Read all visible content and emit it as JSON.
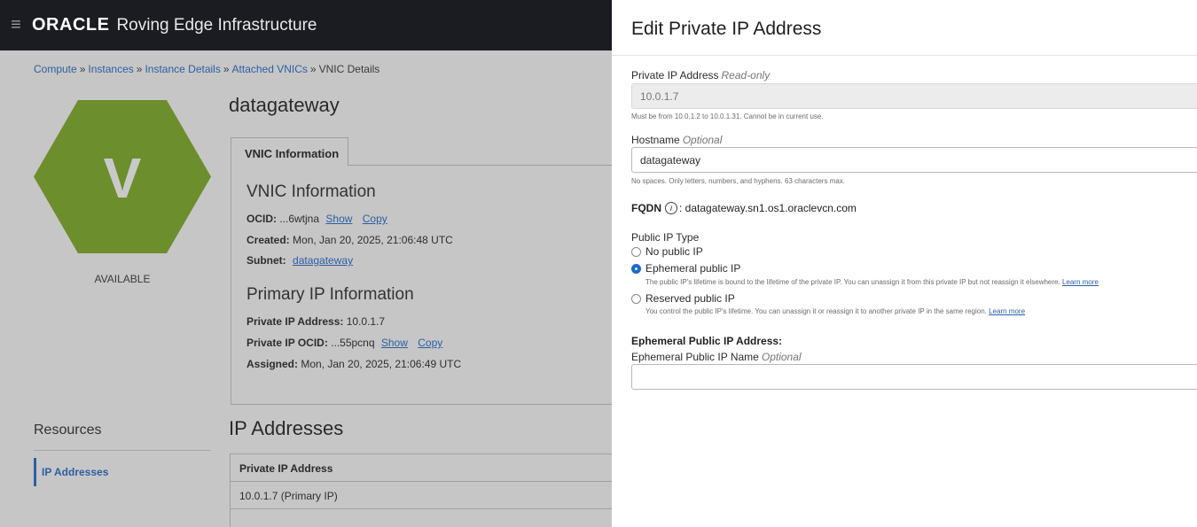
{
  "header": {
    "menu_icon": "hamburger-icon",
    "logo": "ORACLE",
    "product": "Roving Edge Infrastructure"
  },
  "breadcrumb": {
    "items": [
      "Compute",
      "Instances",
      "Instance Details",
      "Attached VNICs"
    ],
    "separator": "»",
    "current": "VNIC Details"
  },
  "resource": {
    "badge_letter": "V",
    "badge_color": "#6c8e2d",
    "status": "AVAILABLE",
    "name": "datagateway"
  },
  "tabs": [
    {
      "label": "VNIC Information"
    }
  ],
  "vnic_info": {
    "heading": "VNIC Information",
    "ocid_label": "OCID:",
    "ocid_value": "...6wtjna",
    "show_link": "Show",
    "copy_link": "Copy",
    "created_label": "Created:",
    "created_value": "Mon, Jan 20, 2025, 21:06:48 UTC",
    "subnet_label": "Subnet:",
    "subnet_value": "datagateway"
  },
  "primary_ip": {
    "heading": "Primary IP Information",
    "private_ip_label": "Private IP Address:",
    "private_ip_value": "10.0.1.7",
    "ocid_label": "Private IP OCID:",
    "ocid_value": "...55pcnq",
    "show_link": "Show",
    "copy_link": "Copy",
    "assigned_label": "Assigned:",
    "assigned_value": "Mon, Jan 20, 2025, 21:06:49 UTC"
  },
  "resources": {
    "heading": "Resources",
    "items": [
      {
        "label": "IP Addresses"
      }
    ]
  },
  "ip_section": {
    "heading": "IP Addresses",
    "columns": [
      "Private IP Address"
    ],
    "rows": [
      "10.0.1.7 (Primary IP)"
    ]
  },
  "drawer": {
    "title": "Edit Private IP Address",
    "private_ip": {
      "label": "Private IP Address",
      "qualifier": "Read-only",
      "value": "10.0.1.7",
      "hint": "Must be from 10.0.1.2 to 10.0.1.31. Cannot be in current use."
    },
    "hostname": {
      "label": "Hostname",
      "qualifier": "Optional",
      "value": "datagateway",
      "hint": "No spaces. Only letters, numbers, and hyphens. 63 characters max."
    },
    "fqdn": {
      "label": "FQDN",
      "info_icon": "info-icon",
      "value": ": datagateway.sn1.os1.oraclevcn.com"
    },
    "public_ip_type": {
      "label": "Public IP Type",
      "selected": "Ephemeral public IP",
      "options": [
        {
          "label": "No public IP",
          "hint": "",
          "learn_more": ""
        },
        {
          "label": "Ephemeral public IP",
          "hint": "The public IP's lifetime is bound to the lifetime of the private IP. You can unassign it from this private IP but not reassign it elsewhere.",
          "learn_more": "Learn more"
        },
        {
          "label": "Reserved public IP",
          "hint": "You control the public IP's lifetime. You can unassign it or reassign it to another private IP in the same region.",
          "learn_more": "Learn more"
        }
      ]
    },
    "ephemeral": {
      "heading": "Ephemeral Public IP Address:",
      "name_label": "Ephemeral Public IP Name",
      "name_qualifier": "Optional",
      "name_value": ""
    }
  }
}
